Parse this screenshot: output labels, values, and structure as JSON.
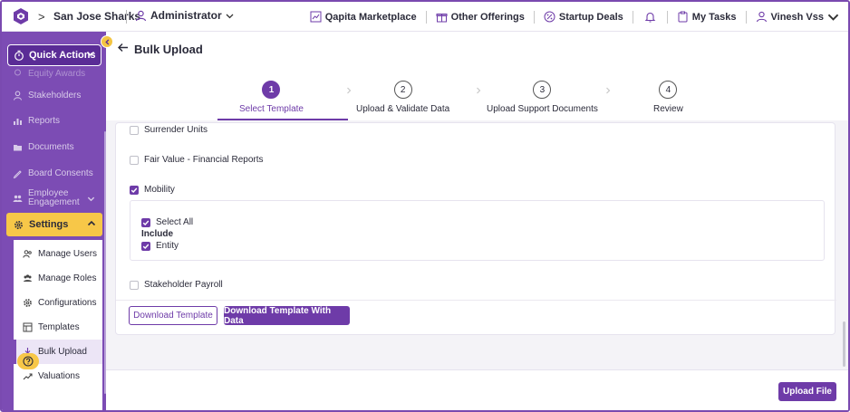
{
  "topbar": {
    "company": "San Jose Sharks",
    "breadcrumb_sep": ">",
    "role": "Administrator",
    "links": {
      "marketplace": "Qapita Marketplace",
      "offerings": "Other Offerings",
      "deals": "Startup Deals",
      "tasks": "My Tasks",
      "user": "Vinesh Vss"
    }
  },
  "sidebar": {
    "quick_actions": "Quick Actions",
    "items": {
      "equity": "Equity Awards",
      "stakeholders": "Stakeholders",
      "reports": "Reports",
      "documents": "Documents",
      "board": "Board Consents",
      "engagement_line1": "Employee",
      "engagement_line2": "Engagement"
    },
    "settings": "Settings",
    "settings_items": {
      "manage_users": "Manage Users",
      "manage_roles": "Manage Roles",
      "configurations": "Configurations",
      "templates": "Templates",
      "bulk_upload": "Bulk Upload",
      "valuations": "Valuations"
    }
  },
  "page": {
    "title": "Bulk Upload"
  },
  "stepper": {
    "steps": [
      {
        "num": "1",
        "label": "Select Template"
      },
      {
        "num": "2",
        "label": "Upload & Validate Data"
      },
      {
        "num": "3",
        "label": "Upload Support Documents"
      },
      {
        "num": "4",
        "label": "Review"
      }
    ]
  },
  "options": {
    "surrender": "Surrender Units",
    "fair_value": "Fair Value - Financial Reports",
    "mobility": "Mobility",
    "select_all": "Select All",
    "include": "Include",
    "entity": "Entity",
    "payroll": "Stakeholder Payroll"
  },
  "buttons": {
    "download_template": "Download Template",
    "download_with_data": "Download Template With Data",
    "upload_file": "Upload File"
  },
  "colors": {
    "brand": "#7c4cb4",
    "accent": "#6e3ba8",
    "highlight": "#f7c748"
  }
}
